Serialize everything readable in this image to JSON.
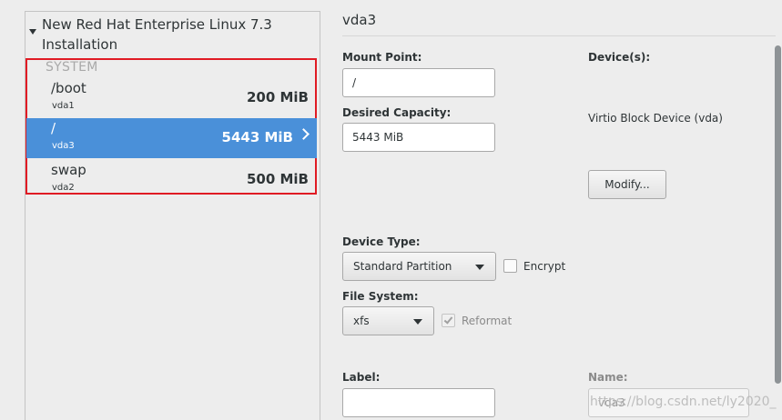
{
  "installation": {
    "title_line1": "New Red Hat Enterprise Linux 7.3",
    "title_line2": "Installation",
    "group_heading": "SYSTEM",
    "mount_points": [
      {
        "name": "/boot",
        "device": "vda1",
        "size": "200 MiB",
        "selected": false
      },
      {
        "name": "/",
        "device": "vda3",
        "size": "5443 MiB",
        "selected": true
      },
      {
        "name": "swap",
        "device": "vda2",
        "size": "500 MiB",
        "selected": false
      }
    ]
  },
  "detail": {
    "title": "vda3",
    "mount_point_label": "Mount Point:",
    "mount_point_value": "/",
    "desired_capacity_label": "Desired Capacity:",
    "desired_capacity_value": "5443 MiB",
    "devices_label": "Device(s):",
    "device_name": "Virtio Block Device (vda)",
    "modify_button": "Modify...",
    "device_type_label": "Device Type:",
    "device_type_value": "Standard Partition",
    "encrypt_label": "Encrypt",
    "encrypt_checked": false,
    "file_system_label": "File System:",
    "file_system_value": "xfs",
    "reformat_label": "Reformat",
    "reformat_checked": true,
    "label_label": "Label:",
    "label_value": "",
    "name_label": "Name:",
    "name_value": "vda3"
  },
  "watermark": "https://blog.csdn.net/ly2020_"
}
